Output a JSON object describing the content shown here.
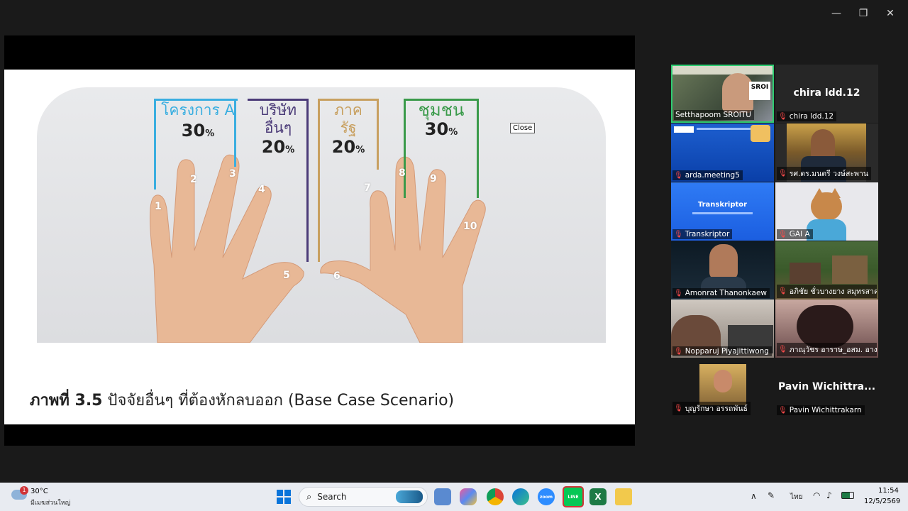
{
  "window": {
    "minimize": "—",
    "restore": "❐",
    "close": "✕"
  },
  "slide": {
    "close_tip": "Close",
    "brackets": [
      {
        "label1": "โครงการ A",
        "label2": "",
        "pct": "30",
        "unit": "%",
        "color": "#3aaee0"
      },
      {
        "label1": "บริษัท",
        "label2": "อื่นๆ",
        "pct": "20",
        "unit": "%",
        "color": "#4b3b78"
      },
      {
        "label1": "ภาค",
        "label2": "รัฐ",
        "pct": "20",
        "unit": "%",
        "color": "#c8a060"
      },
      {
        "label1": "ชุมชน",
        "label2": "",
        "pct": "30",
        "unit": "%",
        "color": "#3a9a4a"
      }
    ],
    "fingers": [
      "1",
      "2",
      "3",
      "4",
      "5",
      "6",
      "7",
      "8",
      "9",
      "10"
    ],
    "caption_bold": "ภาพที่ 3.5",
    "caption_text": " ปัจจัยอื่นๆ ที่ต้องหักลบออก (Base Case Scenario)"
  },
  "participants": {
    "t1": "Setthapoom SROITU",
    "t2_big": "chira ldd.12",
    "t2": "chira ldd.12",
    "t3": "arda.meeting5",
    "t4": "รศ.ดร.มนตรี วงษ์สะพาน",
    "t5": "Transkriptor",
    "t5_logo": "Transkriptor",
    "t6": "GAI A",
    "t7": "Amonrat Thanonkaew",
    "t8": "อภิชัย ชั่วบางยาง สมุทรสาคร",
    "t9": "Nopparuj Piyajittiwong",
    "t10": "ภาณุวัชร อาราษ_อสม. อางทอง",
    "t11": "บุญรักษา อรรถพันธ์",
    "t12_big": "Pavin  Wichittra...",
    "t12": "Pavin Wichittrakarn",
    "sroi": "SROI"
  },
  "taskbar": {
    "weather_temp": "30°C",
    "weather_desc": "มีเมฆส่วนใหญ่",
    "weather_badge": "1",
    "search": "Search",
    "lang": "ไทย",
    "time": "11:54",
    "date": "12/5/2569"
  }
}
